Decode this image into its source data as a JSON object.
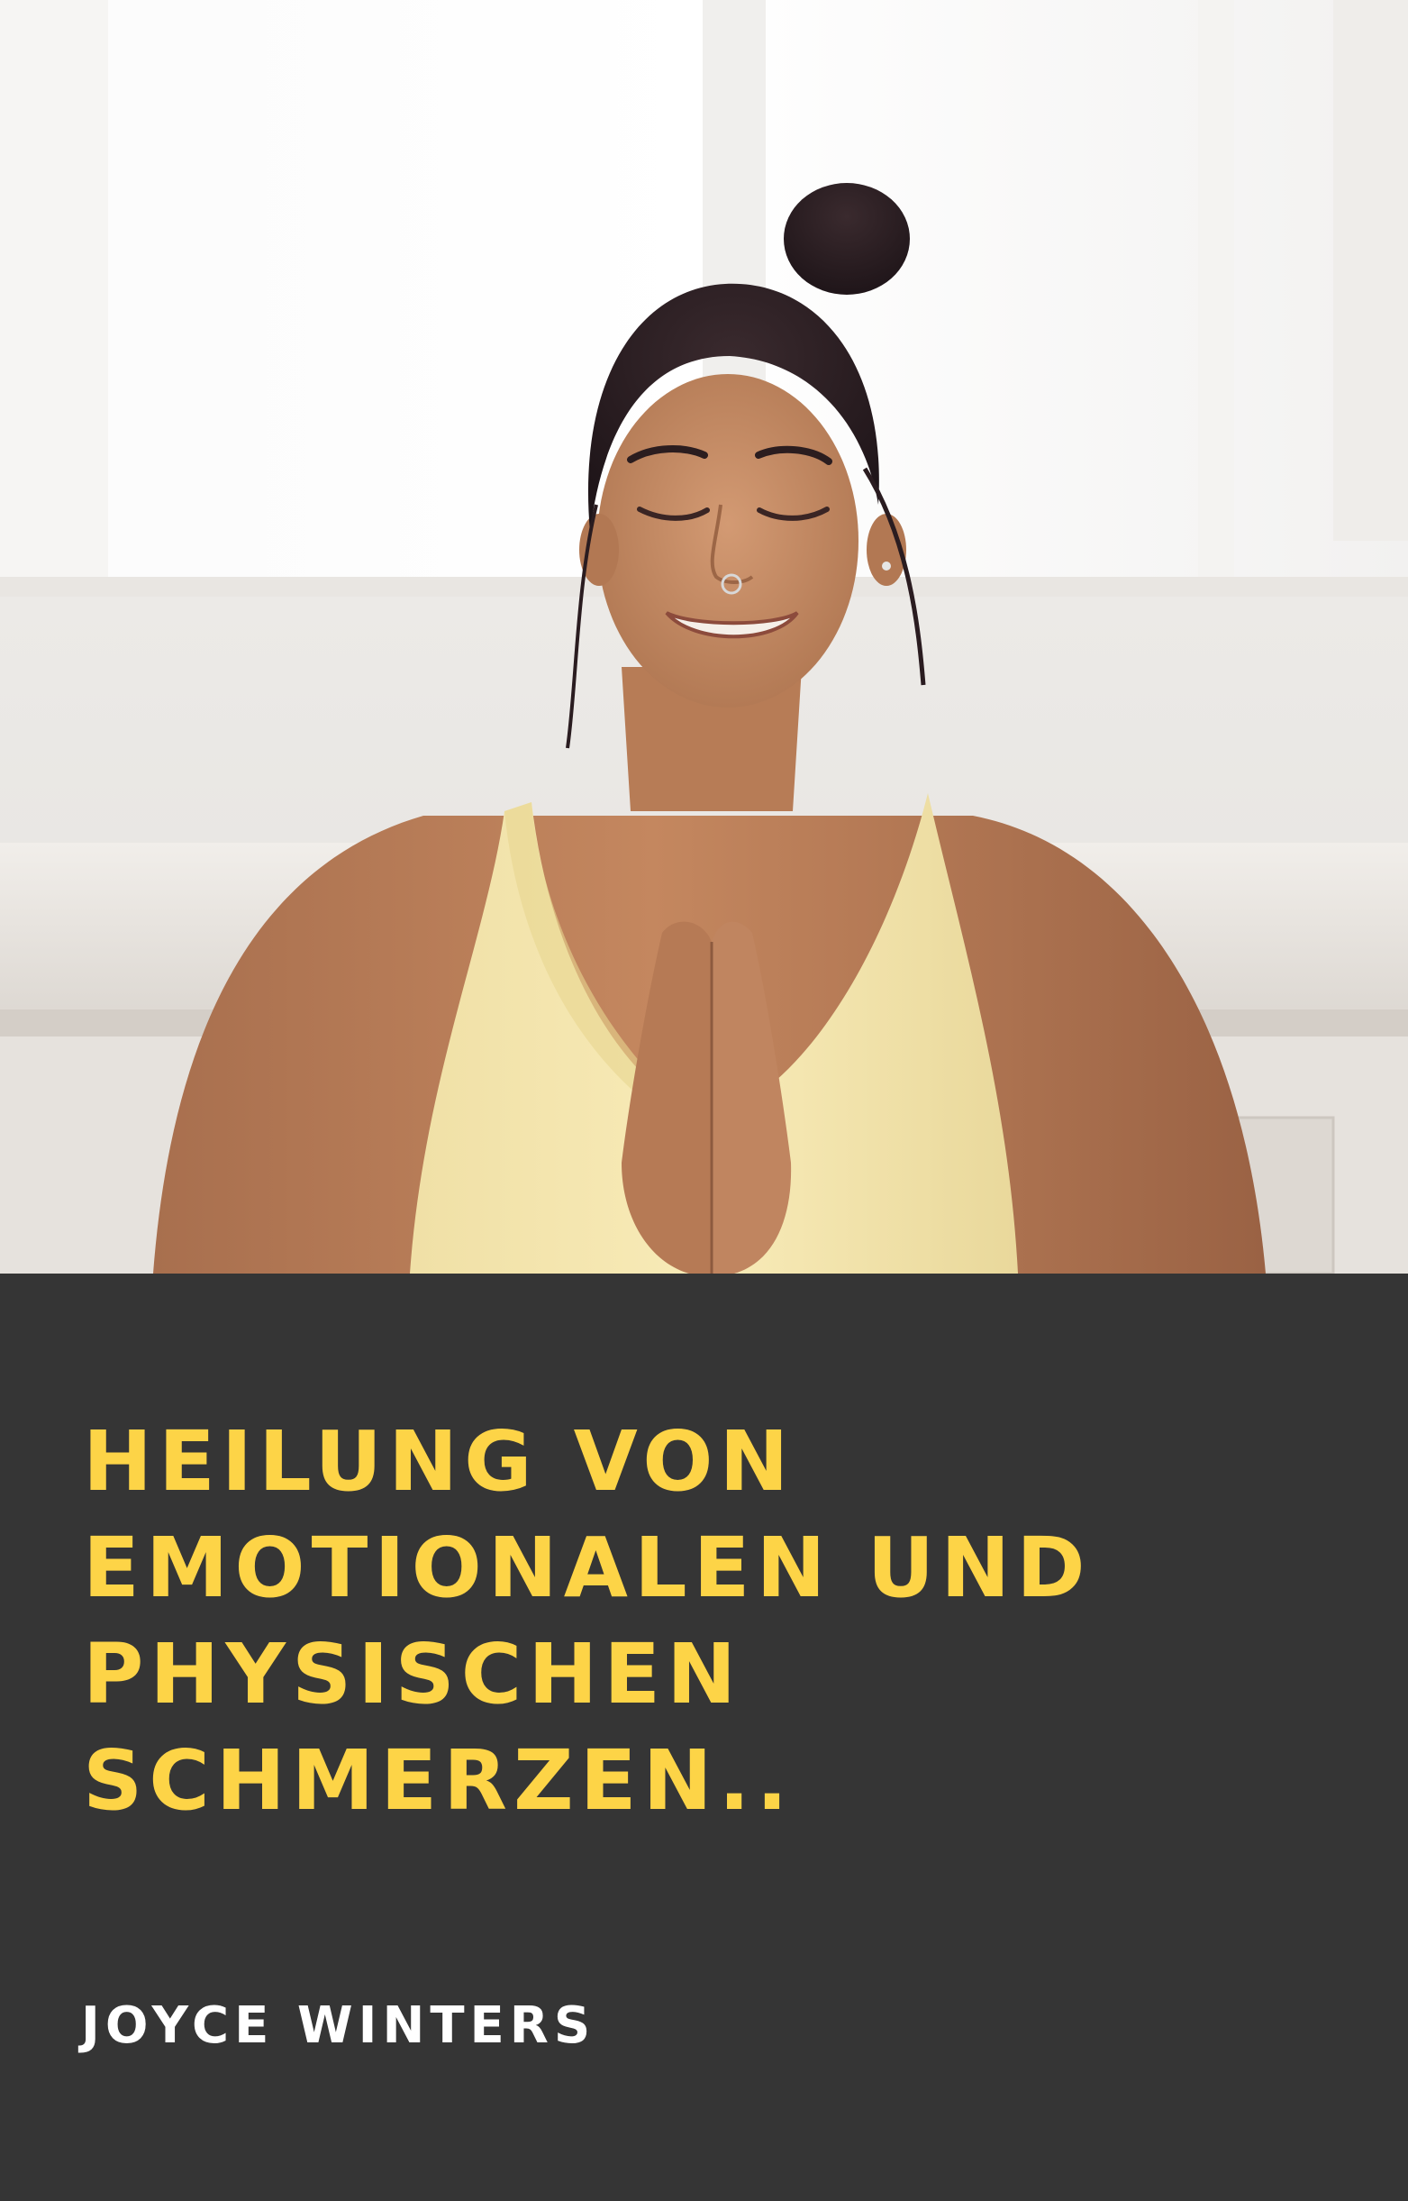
{
  "cover": {
    "title_lines": [
      "HEILUNG VON",
      "EMOTIONALEN UND",
      "PHYSISCHEN",
      "SCHMERZEN.."
    ],
    "author": "JOYCE WINTERS",
    "colors": {
      "panel": "#353535",
      "title": "#fdd447",
      "author": "#ffffff"
    },
    "photo": "woman-meditating-with-prayer-hands"
  }
}
